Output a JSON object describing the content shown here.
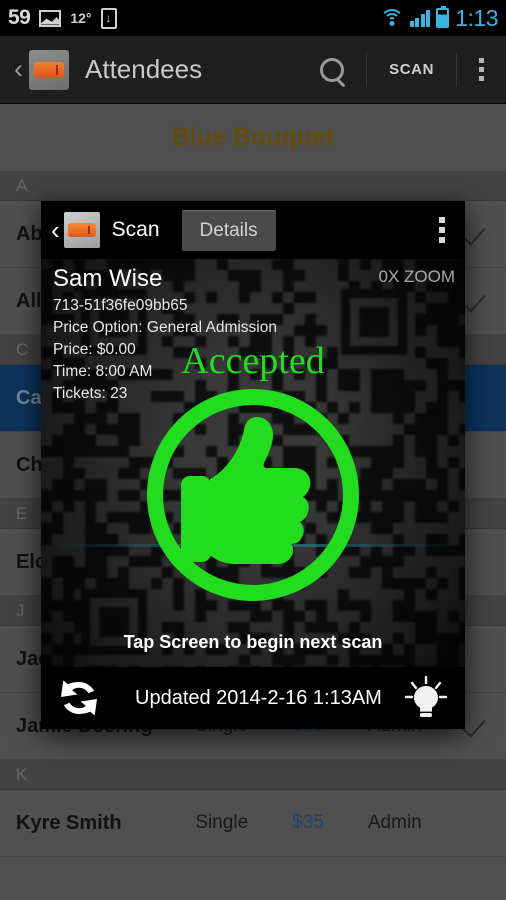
{
  "status_bar": {
    "notification_count": "59",
    "temperature": "12°",
    "clock": "1:13",
    "icons": [
      "photo-icon",
      "download-icon",
      "wifi-icon",
      "signal-icon",
      "battery-icon"
    ],
    "accent_color": "#3bb4e0"
  },
  "action_bar": {
    "back_label": "‹",
    "app_logo": "ticket-stub-icon",
    "title": "Attendees",
    "search_icon": "search-icon",
    "scan_label": "SCAN",
    "overflow_icon": "overflow-menu-icon"
  },
  "list": {
    "event_title": "Blue Bouquet",
    "event_title_color": "#8a6a14",
    "selected_row_color": "#12477f",
    "price_color": "#2a5c9c",
    "sections": [
      {
        "letter": "A",
        "rows": [
          {
            "name": "Abb",
            "type": "",
            "price": "",
            "role": "",
            "checked": true,
            "selected": false
          },
          {
            "name": "Allis",
            "type": "",
            "price": "",
            "role": "",
            "checked": true,
            "selected": false
          }
        ]
      },
      {
        "letter": "C",
        "rows": [
          {
            "name": "Can",
            "type": "",
            "price": "",
            "role": "",
            "checked": false,
            "selected": true
          },
          {
            "name": "Chr",
            "type": "",
            "price": "",
            "role": "",
            "checked": false,
            "selected": false
          }
        ]
      },
      {
        "letter": "E",
        "rows": [
          {
            "name": "Elon",
            "type": "",
            "price": "",
            "role": "",
            "checked": false,
            "selected": false
          }
        ]
      },
      {
        "letter": "J",
        "rows": [
          {
            "name": "Jac",
            "type": "",
            "price": "",
            "role": "",
            "checked": false,
            "selected": false
          },
          {
            "name": "Jamie Deering",
            "type": "Single",
            "price": "$35",
            "role": "Admin",
            "checked": true,
            "selected": false
          }
        ]
      },
      {
        "letter": "K",
        "rows": [
          {
            "name": "Kyre Smith",
            "type": "Single",
            "price": "$35",
            "role": "Admin",
            "checked": false,
            "selected": false
          }
        ]
      }
    ]
  },
  "scan_dialog": {
    "back_label": "‹",
    "app_logo": "ticket-stub-icon",
    "title": "Scan",
    "details_label": "Details",
    "overflow_icon": "overflow-menu-icon",
    "zoom_label": "0X ZOOM",
    "attendee": {
      "name": "Sam Wise",
      "code": "713-51f36fe09bb65",
      "price_option": "Price Option: General Admission",
      "price": "Price: $0.00",
      "time": "Time: 8:00 AM",
      "tickets": "Tickets: 23"
    },
    "result_label": "Accepted",
    "result_color": "#22dd1e",
    "result_icon": "thumbs-up-icon",
    "tap_hint": "Tap Screen to begin next scan",
    "refresh_icon": "refresh-icon",
    "updated_label": "Updated 2014-2-16 1:13AM",
    "flash_icon": "lightbulb-icon"
  }
}
